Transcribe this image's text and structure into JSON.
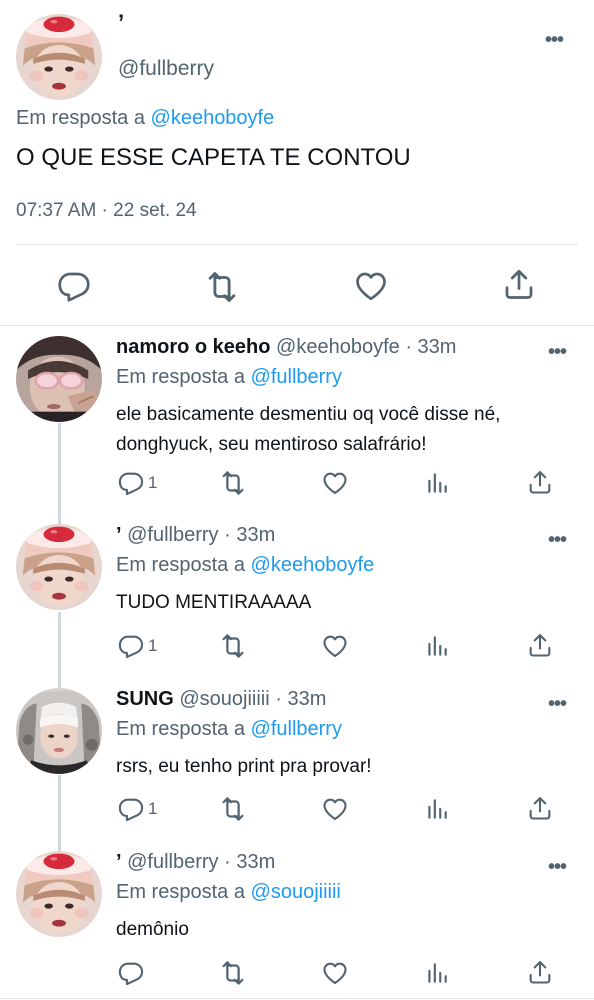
{
  "main_tweet": {
    "display_name": "’",
    "handle": "@fullberry",
    "reply_prefix": "Em resposta a",
    "reply_to": "@keehoboyfe",
    "text": "O QUE ESSE CAPETA TE CONTOU",
    "timestamp": "07:37 AM · 22 set. 24",
    "more": "•••"
  },
  "replies": [
    {
      "name": "namoro o keeho",
      "handle": "@keehoboyfe · 33m",
      "reply_prefix": "Em resposta a",
      "reply_to": "@fullberry",
      "text": "ele basicamente desmentiu oq você disse né, donghyuck, seu mentiroso salafrário!",
      "reply_count": "1",
      "more": "•••"
    },
    {
      "name": "’",
      "handle": "@fullberry · 33m",
      "reply_prefix": "Em resposta a",
      "reply_to": "@keehoboyfe",
      "text": "TUDO MENTIRAAAAA",
      "reply_count": "1",
      "more": "•••"
    },
    {
      "name": "SUNG",
      "handle": "@souojiiiii · 33m",
      "reply_prefix": "Em resposta a",
      "reply_to": "@fullberry",
      "text": "rsrs, eu tenho print pra provar!",
      "reply_count": "1",
      "more": "•••"
    },
    {
      "name": "’",
      "handle": "@fullberry · 33m",
      "reply_prefix": "Em resposta a",
      "reply_to": "@souojiiiii",
      "text": "demônio",
      "reply_count": "",
      "more": "•••"
    }
  ],
  "icons": {
    "reply": "reply-icon",
    "retweet": "retweet-icon",
    "like": "heart-icon",
    "share": "share-icon",
    "views": "views-icon",
    "more": "more-icon"
  },
  "colors": {
    "link": "#1d9bf0",
    "secondary_text": "#536471",
    "primary_text": "#0f1419",
    "divider": "#e1e6ea"
  }
}
